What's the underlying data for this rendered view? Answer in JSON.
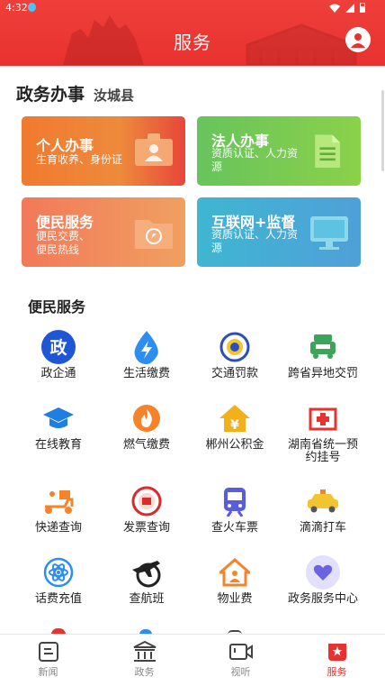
{
  "status_bar": {
    "time": "4:32"
  },
  "header": {
    "title": "服务"
  },
  "section": {
    "title": "政务办事",
    "county": "汝城县"
  },
  "cards": [
    {
      "title": "个人办事",
      "subtitle": "生育收养、身份证",
      "color": "#ee8a3c"
    },
    {
      "title": "法人办事",
      "subtitle": "资质认证、人力资源",
      "color": "#7ccc50"
    },
    {
      "title": "便民服务",
      "subtitle": "便民交费、便民热线",
      "color": "#f08a5c"
    },
    {
      "title": "互联网+监督",
      "subtitle": "资质认证、人力资源",
      "color": "#45acd5"
    }
  ],
  "services": {
    "title": "便民服务",
    "items": [
      {
        "label": "政企通",
        "icon": "zheng-badge-icon"
      },
      {
        "label": "生活缴费",
        "icon": "water-drop-bolt-icon"
      },
      {
        "label": "交通罚款",
        "icon": "police-emblem-icon"
      },
      {
        "label": "跨省异地交罚",
        "icon": "car-icon"
      },
      {
        "label": "在线教育",
        "icon": "graduation-cap-icon"
      },
      {
        "label": "燃气缴费",
        "icon": "flame-icon"
      },
      {
        "label": "郴州公积金",
        "icon": "house-yen-icon"
      },
      {
        "label": "湖南省统一预约挂号",
        "icon": "hospital-icon"
      },
      {
        "label": "快递查询",
        "icon": "delivery-scooter-icon"
      },
      {
        "label": "发票查询",
        "icon": "invoice-seal-icon"
      },
      {
        "label": "查火车票",
        "icon": "train-icon"
      },
      {
        "label": "滴滴打车",
        "icon": "taxi-icon"
      },
      {
        "label": "话费充值",
        "icon": "atom-icon"
      },
      {
        "label": "查航班",
        "icon": "airplane-globe-icon"
      },
      {
        "label": "物业费",
        "icon": "house-person-icon"
      },
      {
        "label": "政务服务中心",
        "icon": "heart-hands-icon"
      }
    ]
  },
  "nav": [
    {
      "label": "新闻",
      "icon": "news-icon"
    },
    {
      "label": "政务",
      "icon": "government-building-icon"
    },
    {
      "label": "视听",
      "icon": "video-camera-icon"
    },
    {
      "label": "服务",
      "icon": "service-star-icon",
      "active": true
    }
  ],
  "colors": {
    "brand_red": "#e8322f",
    "active_tab": "#e8322f"
  }
}
